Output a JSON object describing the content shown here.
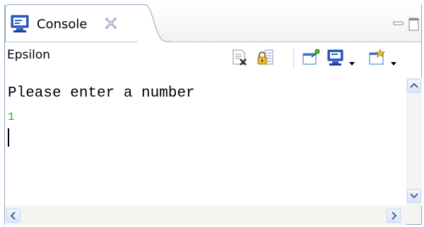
{
  "tab": {
    "label": "Console",
    "icon": "console-monitor-icon",
    "close_icon": "close-icon"
  },
  "window_controls": [
    "minimize-icon",
    "maximize-icon"
  ],
  "toolbar": {
    "console_name": "Epsilon",
    "buttons": [
      "clear-console-icon",
      "scroll-lock-icon",
      "pin-console-icon",
      "display-selected-console-icon",
      "open-console-icon"
    ]
  },
  "console": {
    "output": "Please enter a number",
    "input": "1",
    "input_color": "#00c800",
    "output_color": "#000000"
  },
  "colors": {
    "border": "#8fa5c2",
    "scroll_track": "#f4f4f0",
    "scroll_button": "#d9e4fb",
    "accent": "#3a6fd8"
  }
}
